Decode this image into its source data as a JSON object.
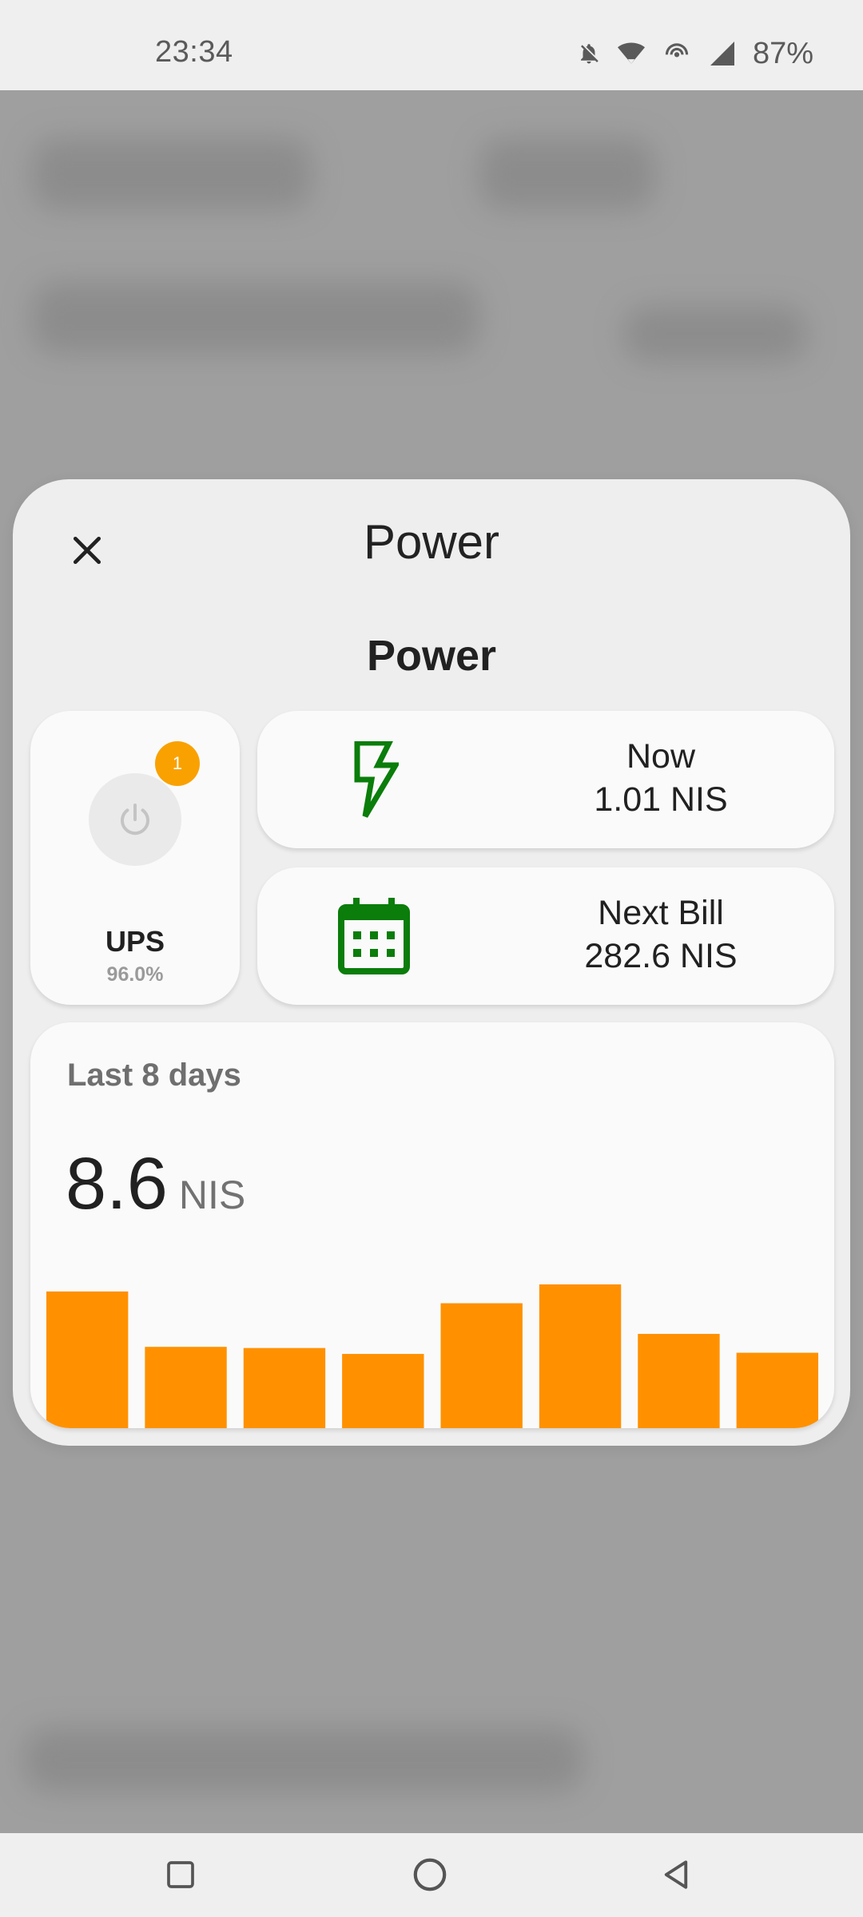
{
  "status_bar": {
    "time": "23:34",
    "battery": "87%",
    "icons": [
      "notifications-off-icon",
      "wifi-icon",
      "hotspot-icon",
      "signal-icon"
    ]
  },
  "dialog": {
    "title": "Power",
    "section_title": "Power",
    "close_icon": "close-icon"
  },
  "ups": {
    "name": "UPS",
    "value": "96.0%",
    "badge": "1",
    "icon": "power-icon"
  },
  "now": {
    "label": "Now",
    "value": "1.01 NIS",
    "icon": "lightning-icon",
    "icon_color": "#0a7d0a"
  },
  "next_bill": {
    "label": "Next Bill",
    "value": "282.6 NIS",
    "icon": "calendar-icon",
    "icon_color": "#0a7d0a"
  },
  "history": {
    "label": "Last 8 days",
    "total": "8.6",
    "unit": "NIS"
  },
  "chart_data": {
    "type": "bar",
    "values": [
      1.16,
      0.69,
      0.68,
      0.63,
      1.06,
      1.22,
      0.8,
      0.64
    ],
    "bar_color": "#ff9100"
  },
  "nav_bar": {
    "buttons": [
      "recents-icon",
      "home-icon",
      "back-icon"
    ]
  }
}
